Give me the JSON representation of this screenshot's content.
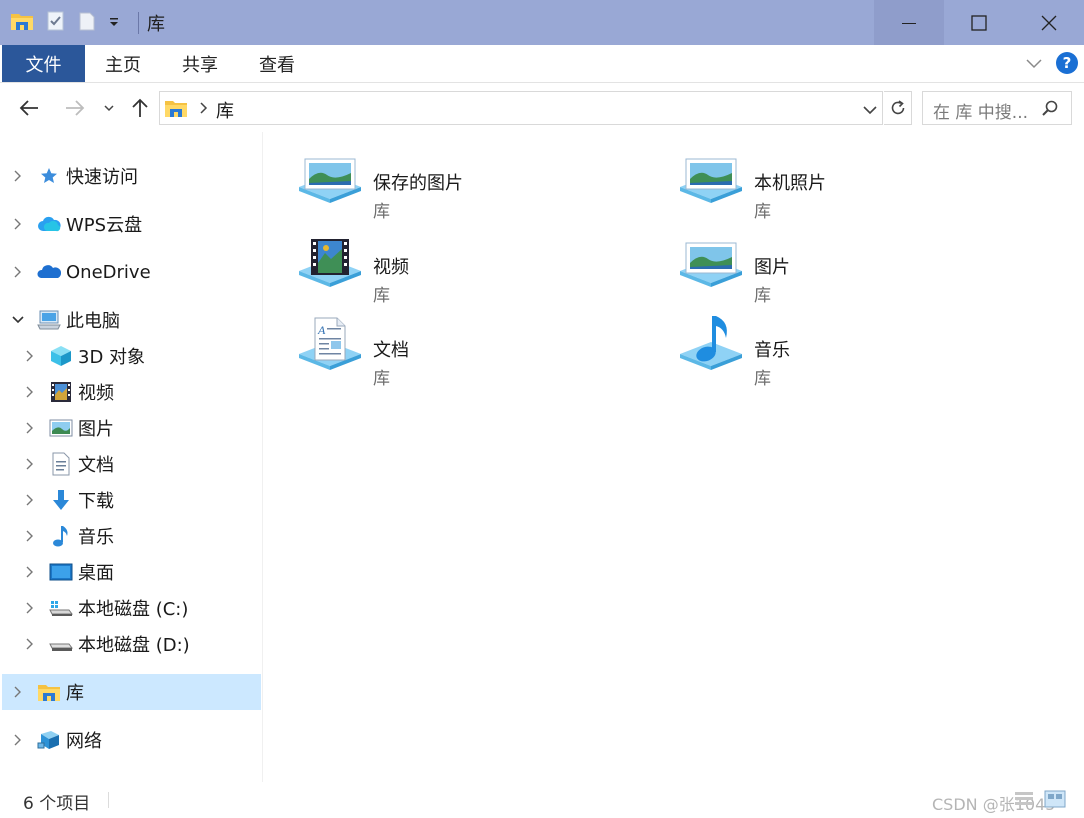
{
  "window": {
    "title": "库",
    "colors": {
      "titlebar": "#99a8d5",
      "file_tab": "#2b579a",
      "selected": "#cce8ff",
      "accent": "#1a6fd4"
    }
  },
  "quick_access_toolbar": {
    "icons": [
      "folder-icon",
      "properties-icon",
      "new-folder-icon",
      "customize-dropdown-icon"
    ]
  },
  "window_controls": {
    "icons": [
      "minimize-icon",
      "maximize-icon",
      "close-icon"
    ]
  },
  "ribbon": {
    "tabs": [
      {
        "label": "文件"
      },
      {
        "label": "主页"
      },
      {
        "label": "共享"
      },
      {
        "label": "查看"
      }
    ],
    "help_label": "?"
  },
  "address_bar": {
    "path": "库",
    "search_placeholder": "在 库 中搜..."
  },
  "sidebar": {
    "items": [
      {
        "label": "快速访问",
        "icon": "star-icon"
      },
      {
        "label": "WPS云盘",
        "icon": "cloud-icon"
      },
      {
        "label": "OneDrive",
        "icon": "onedrive-icon"
      },
      {
        "label": "此电脑",
        "icon": "computer-icon",
        "expanded": true
      },
      {
        "label": "3D 对象",
        "icon": "cube-icon"
      },
      {
        "label": "视频",
        "icon": "video-icon"
      },
      {
        "label": "图片",
        "icon": "picture-icon"
      },
      {
        "label": "文档",
        "icon": "document-icon"
      },
      {
        "label": "下载",
        "icon": "download-icon"
      },
      {
        "label": "音乐",
        "icon": "music-icon"
      },
      {
        "label": "桌面",
        "icon": "desktop-icon"
      },
      {
        "label": "本地磁盘 (C:)",
        "icon": "system-drive-icon"
      },
      {
        "label": "本地磁盘 (D:)",
        "icon": "drive-icon"
      },
      {
        "label": "库",
        "icon": "library-icon",
        "selected": true
      },
      {
        "label": "网络",
        "icon": "network-icon"
      }
    ]
  },
  "libraries": [
    {
      "name": "保存的图片",
      "sub": "库",
      "icon": "picture-library-icon"
    },
    {
      "name": "本机照片",
      "sub": "库",
      "icon": "picture-library-icon"
    },
    {
      "name": "视频",
      "sub": "库",
      "icon": "video-library-icon"
    },
    {
      "name": "图片",
      "sub": "库",
      "icon": "picture-library-icon"
    },
    {
      "name": "文档",
      "sub": "库",
      "icon": "document-library-icon"
    },
    {
      "name": "音乐",
      "sub": "库",
      "icon": "music-library-icon"
    }
  ],
  "status_bar": {
    "item_count": "6 个项目",
    "watermark": "CSDN @张1045"
  }
}
